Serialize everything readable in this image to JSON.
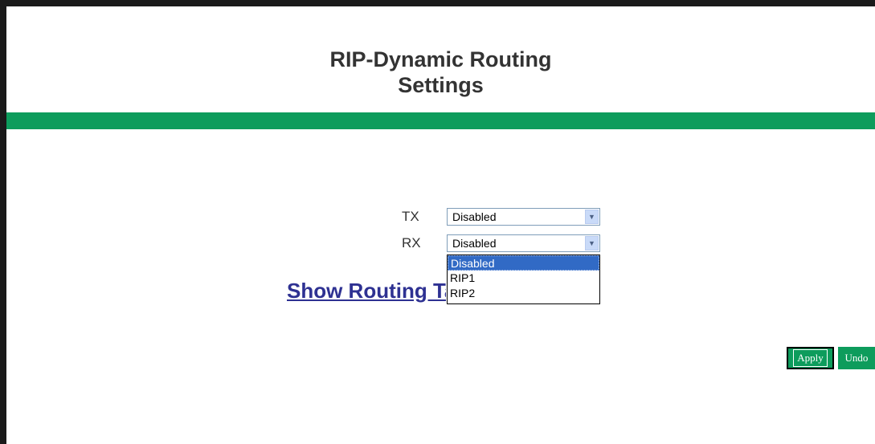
{
  "header": {
    "title_line1": "RIP-Dynamic Routing",
    "title_line2": "Settings"
  },
  "form": {
    "tx": {
      "label": "TX",
      "value": "Disabled"
    },
    "rx": {
      "label": "RX",
      "value": "Disabled"
    },
    "rx_options": [
      "Disabled",
      "RIP1",
      "RIP2"
    ]
  },
  "links": {
    "show_routing": "Show Routing Table"
  },
  "buttons": {
    "apply": "Apply",
    "undo": "Undo"
  },
  "colors": {
    "accent_bar": "#0d9c5c",
    "link": "#2e3192",
    "selected_option": "#316ac5"
  }
}
